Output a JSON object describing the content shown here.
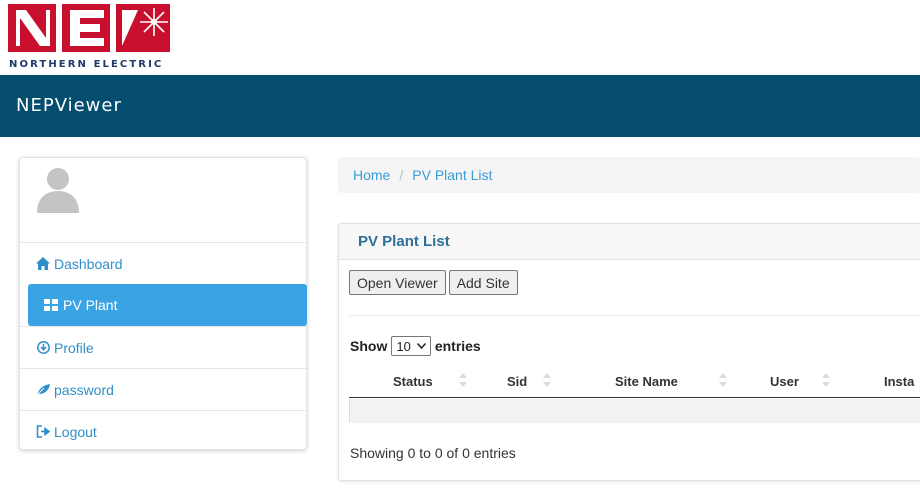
{
  "brand": {
    "logo_text": "NEP",
    "caption": "NORTHERN ELECTRIC",
    "logo_color": "#c8102e"
  },
  "header": {
    "app_title": "NEPViewer",
    "bar_color": "#044d6f"
  },
  "sidebar": {
    "items": [
      {
        "label": "Dashboard",
        "icon": "home-icon",
        "active": false
      },
      {
        "label": "PV Plant",
        "icon": "grid-icon",
        "active": true
      },
      {
        "label": "Profile",
        "icon": "download-circle-icon",
        "active": false
      },
      {
        "label": "password",
        "icon": "leaf-icon",
        "active": false
      },
      {
        "label": "Logout",
        "icon": "logout-icon",
        "active": false
      }
    ]
  },
  "breadcrumb": {
    "home": "Home",
    "current": "PV Plant List",
    "separator": "/"
  },
  "panel": {
    "title": "PV Plant List",
    "buttons": {
      "open_viewer": "Open Viewer",
      "add_site": "Add Site"
    },
    "length": {
      "prefix": "Show",
      "value": "10",
      "suffix": "entries"
    },
    "columns": [
      "Status",
      "Sid",
      "Site Name",
      "User",
      "Insta"
    ],
    "info": "Showing 0 to 0 of 0 entries"
  },
  "colors": {
    "accent": "#3aa3e3",
    "link": "#2f8fc9"
  }
}
